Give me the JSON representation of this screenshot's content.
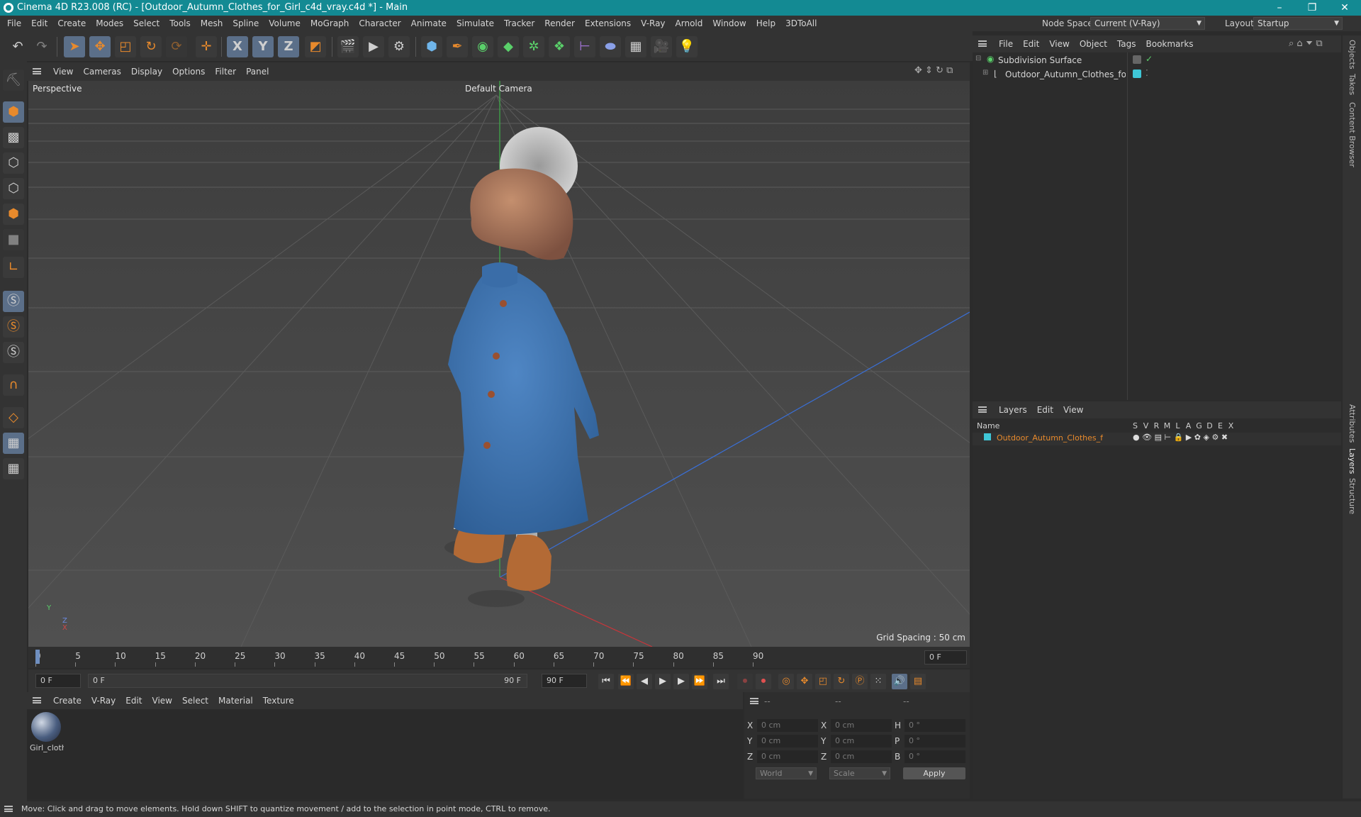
{
  "window": {
    "title": "Cinema 4D R23.008 (RC) - [Outdoor_Autumn_Clothes_for_Girl_c4d_vray.c4d *] - Main",
    "minimize": "–",
    "restore": "❐",
    "close": "✕"
  },
  "menubar": {
    "items": [
      "File",
      "Edit",
      "Create",
      "Modes",
      "Select",
      "Tools",
      "Mesh",
      "Spline",
      "Volume",
      "MoGraph",
      "Character",
      "Animate",
      "Simulate",
      "Tracker",
      "Render",
      "Extensions",
      "V-Ray",
      "Arnold",
      "Window",
      "Help",
      "3DToAll"
    ],
    "node_space_label": "Node Space:",
    "node_space_value": "Current (V-Ray)",
    "layout_label": "Layout:",
    "layout_value": "Startup"
  },
  "toolbar": {
    "axis_x": "X",
    "axis_y": "Y",
    "axis_z": "Z"
  },
  "viewport": {
    "menu": [
      "View",
      "Cameras",
      "Display",
      "Options",
      "Filter",
      "Panel"
    ],
    "label": "Perspective",
    "camera": "Default Camera",
    "grid_spacing": "Grid Spacing : 50 cm",
    "axis_y": "Y",
    "axis_z": "Z",
    "axis_x": "X"
  },
  "timeline": {
    "ticks": [
      "0",
      "5",
      "10",
      "15",
      "20",
      "25",
      "30",
      "35",
      "40",
      "45",
      "50",
      "55",
      "60",
      "65",
      "70",
      "75",
      "80",
      "85",
      "90"
    ],
    "current_frame": "0 F"
  },
  "transport": {
    "start": "0 F",
    "range_start": "0 F",
    "range_end": "90 F",
    "end": "90 F"
  },
  "material_manager": {
    "menu": [
      "Create",
      "V-Ray",
      "Edit",
      "View",
      "Select",
      "Material",
      "Texture"
    ],
    "material_name": "Girl_cloth"
  },
  "coordinates": {
    "header": [
      "--",
      "--",
      "--"
    ],
    "rows": [
      {
        "l1": "X",
        "v1": "0 cm",
        "l2": "X",
        "v2": "0 cm",
        "l3": "H",
        "v3": "0 °"
      },
      {
        "l1": "Y",
        "v1": "0 cm",
        "l2": "Y",
        "v2": "0 cm",
        "l3": "P",
        "v3": "0 °"
      },
      {
        "l1": "Z",
        "v1": "0 cm",
        "l2": "Z",
        "v2": "0 cm",
        "l3": "B",
        "v3": "0 °"
      }
    ],
    "space": "World",
    "mode": "Scale",
    "apply": "Apply"
  },
  "object_manager": {
    "menu": [
      "File",
      "Edit",
      "View",
      "Object",
      "Tags",
      "Bookmarks"
    ],
    "objects": [
      "Subdivision Surface",
      "Outdoor_Autumn_Clothes_for_Girl"
    ]
  },
  "layer_manager": {
    "menu": [
      "Layers",
      "Edit",
      "View"
    ],
    "name_header": "Name",
    "flags": [
      "S",
      "V",
      "R",
      "M",
      "L",
      "A",
      "G",
      "D",
      "E",
      "X"
    ],
    "layer_name": "Outdoor_Autumn_Clothes_for_Girl",
    "layer_color": "#3fc6d6"
  },
  "side_tabs": [
    "Objects",
    "Takes",
    "Content Browser",
    "Attributes",
    "Layers",
    "Structure"
  ],
  "status": "Move: Click and drag to move elements. Hold down SHIFT to quantize movement / add to the selection in point mode, CTRL to remove.",
  "colors": {
    "titlebar": "#138a93",
    "accent_orange": "#e88a2c",
    "selected_blue": "#5b6f89"
  }
}
